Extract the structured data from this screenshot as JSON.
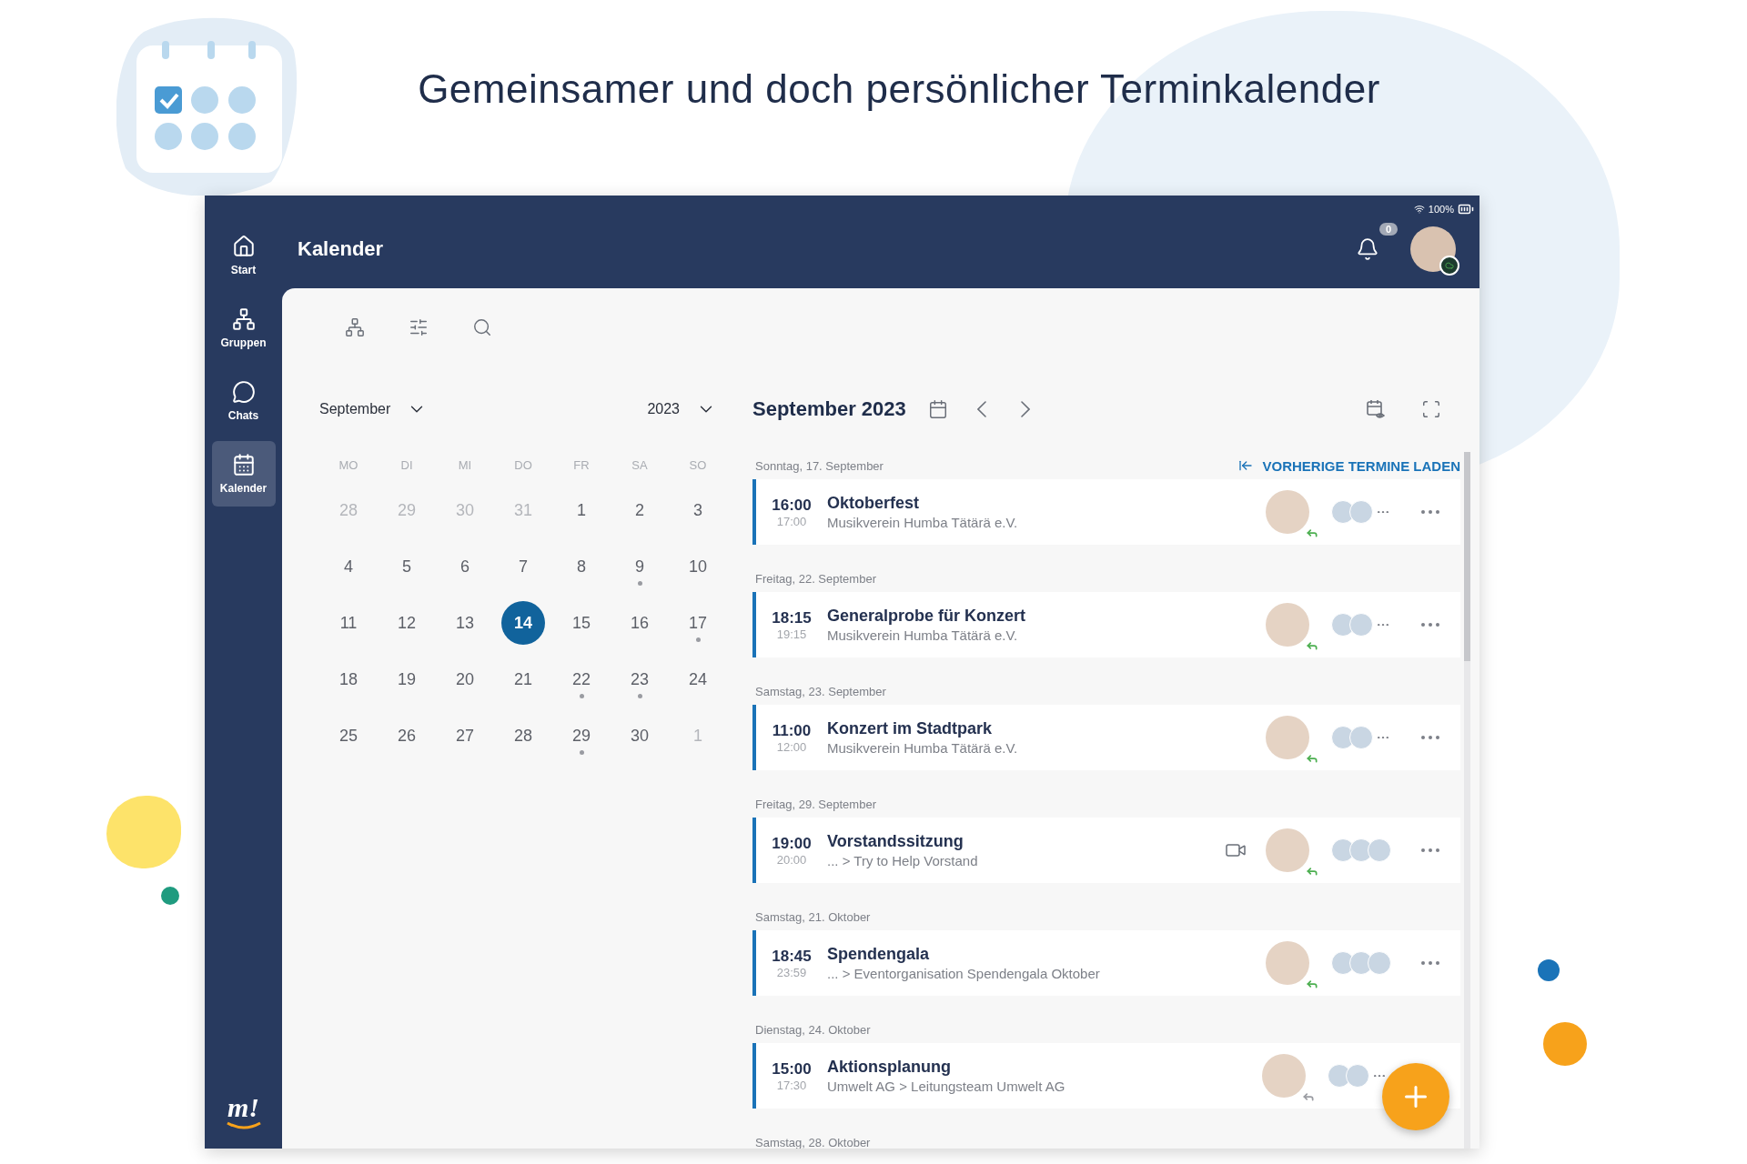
{
  "headline": "Gemeinsamer und doch persönlicher Terminkalender",
  "status_bar": {
    "battery": "100%"
  },
  "sidebar": {
    "items": [
      {
        "kind": "home",
        "label": "Start",
        "selected": false
      },
      {
        "kind": "groups",
        "label": "Gruppen",
        "selected": false
      },
      {
        "kind": "chats",
        "label": "Chats",
        "selected": false
      },
      {
        "kind": "calendar",
        "label": "Kalender",
        "selected": true
      }
    ],
    "logo": "m!"
  },
  "header": {
    "title": "Kalender",
    "notifications": "0"
  },
  "month_picker": {
    "month": "September",
    "year": "2023"
  },
  "weekdays": [
    "MO",
    "DI",
    "MI",
    "DO",
    "FR",
    "SA",
    "SO"
  ],
  "days": [
    {
      "label": "28",
      "muted": true,
      "selected": false,
      "event": false
    },
    {
      "label": "29",
      "muted": true,
      "selected": false,
      "event": false
    },
    {
      "label": "30",
      "muted": true,
      "selected": false,
      "event": false
    },
    {
      "label": "31",
      "muted": true,
      "selected": false,
      "event": false
    },
    {
      "label": "1",
      "muted": false,
      "selected": false,
      "event": false
    },
    {
      "label": "2",
      "muted": false,
      "selected": false,
      "event": false
    },
    {
      "label": "3",
      "muted": false,
      "selected": false,
      "event": false
    },
    {
      "label": "4",
      "muted": false,
      "selected": false,
      "event": false
    },
    {
      "label": "5",
      "muted": false,
      "selected": false,
      "event": false
    },
    {
      "label": "6",
      "muted": false,
      "selected": false,
      "event": false
    },
    {
      "label": "7",
      "muted": false,
      "selected": false,
      "event": false
    },
    {
      "label": "8",
      "muted": false,
      "selected": false,
      "event": false
    },
    {
      "label": "9",
      "muted": false,
      "selected": false,
      "event": true
    },
    {
      "label": "10",
      "muted": false,
      "selected": false,
      "event": false
    },
    {
      "label": "11",
      "muted": false,
      "selected": false,
      "event": false
    },
    {
      "label": "12",
      "muted": false,
      "selected": false,
      "event": false
    },
    {
      "label": "13",
      "muted": false,
      "selected": false,
      "event": false
    },
    {
      "label": "14",
      "muted": false,
      "selected": true,
      "event": false
    },
    {
      "label": "15",
      "muted": false,
      "selected": false,
      "event": false
    },
    {
      "label": "16",
      "muted": false,
      "selected": false,
      "event": false
    },
    {
      "label": "17",
      "muted": false,
      "selected": false,
      "event": true
    },
    {
      "label": "18",
      "muted": false,
      "selected": false,
      "event": false
    },
    {
      "label": "19",
      "muted": false,
      "selected": false,
      "event": false
    },
    {
      "label": "20",
      "muted": false,
      "selected": false,
      "event": false
    },
    {
      "label": "21",
      "muted": false,
      "selected": false,
      "event": false
    },
    {
      "label": "22",
      "muted": false,
      "selected": false,
      "event": true
    },
    {
      "label": "23",
      "muted": false,
      "selected": false,
      "event": true
    },
    {
      "label": "24",
      "muted": false,
      "selected": false,
      "event": false
    },
    {
      "label": "25",
      "muted": false,
      "selected": false,
      "event": false
    },
    {
      "label": "26",
      "muted": false,
      "selected": false,
      "event": false
    },
    {
      "label": "27",
      "muted": false,
      "selected": false,
      "event": false
    },
    {
      "label": "28",
      "muted": false,
      "selected": false,
      "event": false
    },
    {
      "label": "29",
      "muted": false,
      "selected": false,
      "event": true
    },
    {
      "label": "30",
      "muted": false,
      "selected": false,
      "event": false
    },
    {
      "label": "1",
      "muted": true,
      "selected": false,
      "event": false
    }
  ],
  "agenda": {
    "title": "September 2023",
    "load_previous": "VORHERIGE TERMINE LADEN",
    "groups": [
      {
        "date": "Sonntag, 17. September",
        "event": {
          "start": "16:00",
          "end": "17:00",
          "title": "Oktoberfest",
          "subtitle": "Musikverein Humba Tätärä e.V.",
          "video": false,
          "accepted": true,
          "participants": [
            {
              "kind": "person"
            },
            {
              "kind": "person"
            }
          ],
          "overflow": true,
          "menu": true
        }
      },
      {
        "date": "Freitag, 22. September",
        "event": {
          "start": "18:15",
          "end": "19:15",
          "title": "Generalprobe für Konzert",
          "subtitle": "Musikverein Humba Tätärä e.V.",
          "video": false,
          "accepted": true,
          "participants": [
            {
              "kind": "person"
            },
            {
              "kind": "person"
            }
          ],
          "overflow": true,
          "menu": true
        }
      },
      {
        "date": "Samstag, 23. September",
        "event": {
          "start": "11:00",
          "end": "12:00",
          "title": "Konzert im Stadtpark",
          "subtitle": "Musikverein Humba Tätärä e.V.",
          "video": false,
          "accepted": true,
          "participants": [
            {
              "kind": "person"
            },
            {
              "kind": "person"
            }
          ],
          "overflow": true,
          "menu": true
        }
      },
      {
        "date": "Freitag, 29. September",
        "event": {
          "start": "19:00",
          "end": "20:00",
          "title": "Vorstandssitzung",
          "subtitle": "... > Try to Help Vorstand",
          "video": true,
          "accepted": true,
          "participants": [
            {
              "kind": "person"
            },
            {
              "kind": "person"
            },
            {
              "kind": "person"
            }
          ],
          "overflow": false,
          "menu": true
        }
      },
      {
        "date": "Samstag, 21. Oktober",
        "event": {
          "start": "18:45",
          "end": "23:59",
          "title": "Spendengala",
          "subtitle": "... > Eventorganisation Spendengala Oktober",
          "video": false,
          "accepted": true,
          "participants": [
            {
              "kind": "person"
            },
            {
              "kind": "person"
            },
            {
              "kind": "person"
            }
          ],
          "overflow": false,
          "menu": true
        }
      },
      {
        "date": "Dienstag, 24. Oktober",
        "event": {
          "start": "15:00",
          "end": "17:30",
          "title": "Aktionsplanung",
          "subtitle": "Umwelt AG > Leitungsteam Umwelt AG",
          "video": false,
          "accepted": false,
          "participants": [
            {
              "kind": "person"
            },
            {
              "kind": "person"
            }
          ],
          "overflow": true,
          "menu": false
        }
      },
      {
        "date": "Samstag, 28. Oktober"
      }
    ]
  }
}
